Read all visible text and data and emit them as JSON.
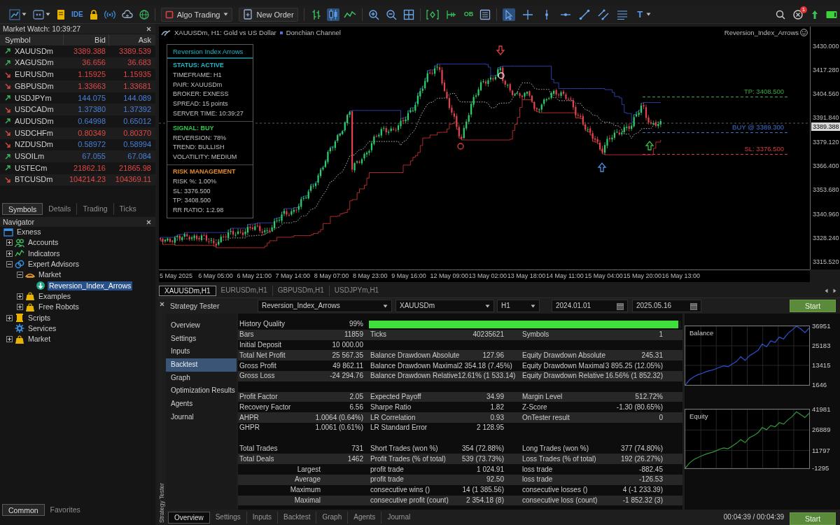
{
  "toolbar": {
    "ide": "IDE",
    "algo_trading": {
      "label": "Algo Trading",
      "on": false
    },
    "new_order": "New Order",
    "chart_types": [
      {
        "selected": false
      },
      {
        "selected": true
      },
      {
        "selected": false
      }
    ],
    "order_book": "OB",
    "tools": [
      {
        "kind": "cursor",
        "selected": true
      },
      {
        "kind": "crosshair",
        "selected": false
      },
      {
        "kind": "vline",
        "selected": false
      },
      {
        "kind": "hline",
        "selected": false
      },
      {
        "kind": "trend",
        "selected": false
      },
      {
        "kind": "channel",
        "selected": false
      },
      {
        "kind": "fibo",
        "selected": false
      },
      {
        "kind": "text",
        "label": "T",
        "selected": false
      }
    ],
    "alerts": "1"
  },
  "market_watch": {
    "title": "Market Watch: 10:39:27",
    "columns": [
      "Symbol",
      "Bid",
      "Ask"
    ],
    "rows": [
      {
        "symbol": "XAUUSDm",
        "bid": "3389.388",
        "ask": "3389.539",
        "daily_up": true,
        "tick_up": false
      },
      {
        "symbol": "XAGUSDm",
        "bid": "36.656",
        "ask": "36.683",
        "daily_up": true,
        "tick_up": false
      },
      {
        "symbol": "EURUSDm",
        "bid": "1.15925",
        "ask": "1.15935",
        "daily_up": false,
        "tick_up": false
      },
      {
        "symbol": "GBPUSDm",
        "bid": "1.33663",
        "ask": "1.33681",
        "daily_up": false,
        "tick_up": false
      },
      {
        "symbol": "USDJPYm",
        "bid": "144.075",
        "ask": "144.089",
        "daily_up": true,
        "tick_up": true
      },
      {
        "symbol": "USDCADm",
        "bid": "1.37380",
        "ask": "1.37392",
        "daily_up": false,
        "tick_up": true
      },
      {
        "symbol": "AUDUSDm",
        "bid": "0.64998",
        "ask": "0.65012",
        "daily_up": true,
        "tick_up": true
      },
      {
        "symbol": "USDCHFm",
        "bid": "0.80349",
        "ask": "0.80370",
        "daily_up": false,
        "tick_up": false
      },
      {
        "symbol": "NZDUSDm",
        "bid": "0.58972",
        "ask": "0.58994",
        "daily_up": false,
        "tick_up": true
      },
      {
        "symbol": "USOILm",
        "bid": "67.055",
        "ask": "67.084",
        "daily_up": true,
        "tick_up": true
      },
      {
        "symbol": "USTECm",
        "bid": "21862.16",
        "ask": "21865.98",
        "daily_up": true,
        "tick_up": false
      },
      {
        "symbol": "BTCUSDm",
        "bid": "104214.23",
        "ask": "104369.11",
        "daily_up": false,
        "tick_up": false
      }
    ],
    "tabs": [
      {
        "label": "Symbols",
        "selected": true
      },
      {
        "label": "Details",
        "selected": false
      },
      {
        "label": "Trading",
        "selected": false
      },
      {
        "label": "Ticks",
        "selected": false
      }
    ]
  },
  "navigator": {
    "title": "Navigator",
    "tree": [
      {
        "label": "Exness",
        "kind": "broker",
        "selected": false,
        "children": [
          {
            "label": "Accounts",
            "kind": "accounts",
            "expanded": false,
            "selected": false
          },
          {
            "label": "Indicators",
            "kind": "indicators",
            "expanded": false,
            "selected": false
          },
          {
            "label": "Expert Advisors",
            "kind": "experts",
            "expanded": true,
            "selected": false,
            "children": [
              {
                "label": "Market",
                "kind": "market",
                "expanded": true,
                "selected": false,
                "children": [
                  {
                    "label": "Reversion_Index_Arrows",
                    "kind": "expert",
                    "selected": true
                  }
                ]
              },
              {
                "label": "Examples",
                "kind": "folder",
                "expanded": false,
                "selected": false
              },
              {
                "label": "Free Robots",
                "kind": "folder",
                "expanded": false,
                "selected": false
              }
            ]
          },
          {
            "label": "Scripts",
            "kind": "scripts",
            "expanded": false,
            "selected": false
          },
          {
            "label": "Services",
            "kind": "services",
            "selected": false
          },
          {
            "label": "Market",
            "kind": "store",
            "expanded": false,
            "selected": false
          }
        ]
      }
    ],
    "tabs": [
      {
        "label": "Common",
        "selected": true
      },
      {
        "label": "Favorites",
        "selected": false
      }
    ]
  },
  "chart": {
    "title": "XAUUSDm, H1: Gold vs US Dollar",
    "indicator": "Donchian Channel",
    "expert": "Reversion_Index_Arrows",
    "info_panel": {
      "title": "Reversion Index Arrows",
      "sections": [
        {
          "heading": "STATUS: ACTIVE",
          "color": "#1fb8c8",
          "lines": [
            "TIMEFRAME: H1",
            "PAIR: XAUUSDm",
            "BROKER: EXNESS",
            "SPREAD: 15 points",
            "SERVER TIME: 10:39:27"
          ]
        },
        {
          "heading": "SIGNAL: BUY",
          "color": "#2fc84a",
          "lines": [
            "REVERSION: 78%",
            "TREND: BULLISH",
            "VOLATILITY: MEDIUM"
          ]
        },
        {
          "heading": "RISK MANAGEMENT",
          "color": "#e08a2a",
          "lines": [
            "RISK %: 1.00%",
            "SL: 3376.500",
            "TP: 3408.500",
            "RR RATIO: 1:2.98"
          ]
        }
      ]
    },
    "levels": [
      {
        "label": "TP: 3408.500",
        "color": "#3aa845"
      },
      {
        "label": "BUY @ 3389.300",
        "color": "#3a6fd0"
      },
      {
        "label": "SL: 3376.500",
        "color": "#d23c3c"
      }
    ],
    "price_labels": [
      "3430.000",
      "3417.280",
      "3404.560",
      "3391.840",
      "3379.120",
      "3366.400",
      "3353.680",
      "3340.960",
      "3328.240",
      "3315.520"
    ],
    "current_price": "3389.388",
    "time_labels": [
      "5 May 2025",
      "6 May 05:00",
      "6 May 21:00",
      "7 May 14:00",
      "8 May 07:00",
      "8 May 23:00",
      "9 May 16:00",
      "12 May 09:00",
      "13 May 02:00",
      "13 May 18:00",
      "14 May 11:00",
      "15 May 04:00",
      "15 May 20:00",
      "16 May 13:00"
    ]
  },
  "chart_tabs": [
    {
      "label": "XAUUSDm,H1",
      "selected": true
    },
    {
      "label": "EURUSDm,H1",
      "selected": false
    },
    {
      "label": "GBPUSDm,H1",
      "selected": false
    },
    {
      "label": "USDJPYm,H1",
      "selected": false
    }
  ],
  "tester": {
    "side_label": "Strategy Tester",
    "title": "Strategy Tester",
    "expert": "Reversion_Index_Arrows",
    "symbol": "XAUUSDm",
    "period": "H1",
    "date_from": "2024.01.01",
    "date_to": "2025.05.16",
    "start": "Start",
    "nav": [
      {
        "label": "Overview",
        "selected": false
      },
      {
        "label": "Settings",
        "selected": false
      },
      {
        "label": "Inputs",
        "selected": false
      },
      {
        "label": "Backtest",
        "selected": true
      },
      {
        "label": "Graph",
        "selected": false
      },
      {
        "label": "Optimization Results",
        "selected": false
      },
      {
        "label": "Agents",
        "selected": false
      },
      {
        "label": "Journal",
        "selected": false
      }
    ],
    "results": [
      {
        "kind": "quality",
        "label": "History Quality",
        "value": "99%",
        "level": 0.99
      },
      {
        "kind": "stats",
        "cells": [
          {
            "label": "Bars",
            "value": "11859"
          },
          {
            "label": "Ticks",
            "value": "40235621"
          },
          {
            "label": "Symbols",
            "value": "1"
          }
        ]
      },
      {
        "kind": "stats",
        "cells": [
          {
            "label": "Initial Deposit",
            "value": "10 000.00"
          }
        ]
      },
      {
        "kind": "stats",
        "cells": [
          {
            "label": "Total Net Profit",
            "value": "25 567.35"
          },
          {
            "label": "Balance Drawdown Absolute",
            "value": "127.96"
          },
          {
            "label": "Equity Drawdown Absolute",
            "value": "245.31"
          }
        ]
      },
      {
        "kind": "stats",
        "cells": [
          {
            "label": "Gross Profit",
            "value": "49 862.11"
          },
          {
            "label": "Balance Drawdown Maximal",
            "value": "2 354.18 (7.45%)"
          },
          {
            "label": "Equity Drawdown Maximal",
            "value": "3 895.25 (12.05%)"
          }
        ]
      },
      {
        "kind": "stats",
        "cells": [
          {
            "label": "Gross Loss",
            "value": "-24 294.76"
          },
          {
            "label": "Balance Drawdown Relative",
            "value": "12.61% (1 533.14)"
          },
          {
            "label": "Equity Drawdown Relative",
            "value": "16.56% (1 852.32)"
          }
        ]
      },
      {
        "kind": "spacer"
      },
      {
        "kind": "stats",
        "cells": [
          {
            "label": "Profit Factor",
            "value": "2.05"
          },
          {
            "label": "Expected Payoff",
            "value": "34.99"
          },
          {
            "label": "Margin Level",
            "value": "512.72%"
          }
        ]
      },
      {
        "kind": "stats",
        "cells": [
          {
            "label": "Recovery Factor",
            "value": "6.56"
          },
          {
            "label": "Sharpe Ratio",
            "value": "1.82"
          },
          {
            "label": "Z-Score",
            "value": "-1.30 (80.65%)"
          }
        ]
      },
      {
        "kind": "stats",
        "cells": [
          {
            "label": "AHPR",
            "value": "1.0064 (0.64%)"
          },
          {
            "label": "LR Correlation",
            "value": "0.93"
          },
          {
            "label": "OnTester result",
            "value": "0"
          }
        ]
      },
      {
        "kind": "stats",
        "cells": [
          {
            "label": "GHPR",
            "value": "1.0061 (0.61%)"
          },
          {
            "label": "LR Standard Error",
            "value": "2 128.95"
          }
        ]
      },
      {
        "kind": "spacer"
      },
      {
        "kind": "stats",
        "cells": [
          {
            "label": "Total Trades",
            "value": "731"
          },
          {
            "label": "Short Trades (won %)",
            "value": "354 (72.88%)"
          },
          {
            "label": "Long Trades (won %)",
            "value": "377 (74.80%)"
          }
        ]
      },
      {
        "kind": "stats",
        "cells": [
          {
            "label": "Total Deals",
            "value": "1462"
          },
          {
            "label": "Profit Trades (% of total)",
            "value": "539 (73.73%)"
          },
          {
            "label": "Loss Trades (% of total)",
            "value": "192 (26.27%)"
          }
        ]
      },
      {
        "kind": "group",
        "label": "Largest",
        "cells": [
          {
            "label": "profit trade",
            "value": "1 024.91"
          },
          {
            "label": "loss trade",
            "value": "-882.45"
          }
        ]
      },
      {
        "kind": "group",
        "label": "Average",
        "cells": [
          {
            "label": "profit trade",
            "value": "92.50"
          },
          {
            "label": "loss trade",
            "value": "-126.53"
          }
        ]
      },
      {
        "kind": "group",
        "label": "Maximum",
        "cells": [
          {
            "label": "consecutive wins ()",
            "value": "14 (1 385.56)"
          },
          {
            "label": "consecutive losses ()",
            "value": "4 (-1 233.39)"
          }
        ]
      },
      {
        "kind": "group",
        "label": "Maximal",
        "cells": [
          {
            "label": "consecutive profit (count)",
            "value": "2 354.18 (8)"
          },
          {
            "label": "consecutive loss (count)",
            "value": "-1 852.32 (3)"
          }
        ]
      }
    ],
    "graphs": [
      {
        "chart_data": {
          "type": "line",
          "title": "Balance",
          "color": "#3050d0",
          "grid": true,
          "tick_labels": "y",
          "yticks": [
            1646,
            13415,
            25183,
            36951
          ],
          "ylim": [
            1646,
            36951
          ],
          "values": [
            1700,
            4800,
            6600,
            7900,
            8700,
            9800,
            10400,
            11200,
            12300,
            13100,
            12600,
            14300,
            15800,
            18600,
            16400,
            19200,
            20800,
            22400,
            26300,
            24600,
            28200,
            27200,
            30400,
            29300,
            32600,
            34700,
            36900,
            35400,
            33100,
            35900
          ]
        }
      },
      {
        "chart_data": {
          "type": "line",
          "title": "Equity",
          "color": "#2f9a3a",
          "grid": true,
          "tick_labels": "y",
          "yticks": [
            -1295,
            11797,
            26889,
            41981
          ],
          "ylim": [
            -1295,
            41981
          ],
          "values": [
            -1200,
            2600,
            5200,
            6700,
            8100,
            9300,
            10200,
            11300,
            12700,
            13700,
            13100,
            15100,
            17200,
            19800,
            17600,
            21200,
            22800,
            24800,
            28700,
            27100,
            30200,
            29200,
            32300,
            31200,
            34300,
            36800,
            40300,
            38200,
            36100,
            39300
          ]
        }
      }
    ],
    "tabs": [
      {
        "label": "Overview",
        "selected": true
      },
      {
        "label": "Settings",
        "selected": false
      },
      {
        "label": "Inputs",
        "selected": false
      },
      {
        "label": "Backtest",
        "selected": false
      },
      {
        "label": "Graph",
        "selected": false
      },
      {
        "label": "Agents",
        "selected": false
      },
      {
        "label": "Journal",
        "selected": false
      }
    ],
    "elapsed": "00:04:39 / 00:04:39",
    "footer_start": "Start"
  }
}
